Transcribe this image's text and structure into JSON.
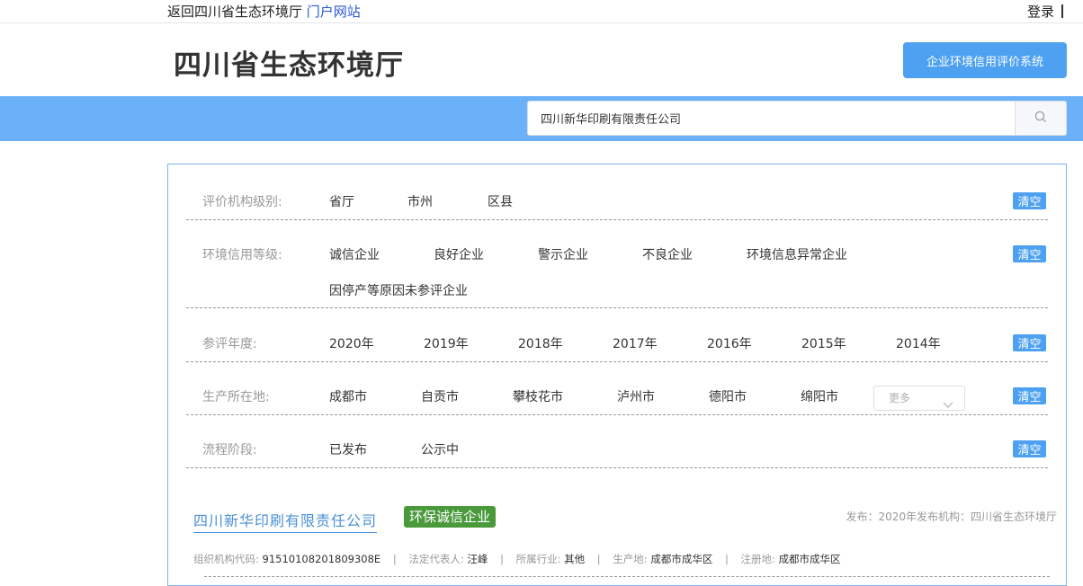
{
  "topbar": {
    "back_text": "返回四川省生态环境厅",
    "portal_link": "门户网站",
    "login": "登录"
  },
  "header": {
    "title": "四川省生态环境厅",
    "system_button": "企业环境信用评价系统"
  },
  "search": {
    "value": "四川新华印刷有限责任公司",
    "icon": "search-icon"
  },
  "filters": {
    "clear_label": "清空",
    "level": {
      "label": "评价机构级别:",
      "options": [
        "省厅",
        "市州",
        "区县"
      ]
    },
    "grade": {
      "label": "环境信用等级:",
      "options": [
        "诚信企业",
        "良好企业",
        "警示企业",
        "不良企业",
        "环境信息异常企业",
        "因停产等原因未参评企业"
      ]
    },
    "year": {
      "label": "参评年度:",
      "options": [
        "2020年",
        "2019年",
        "2018年",
        "2017年",
        "2016年",
        "2015年",
        "2014年"
      ]
    },
    "location": {
      "label": "生产所在地:",
      "options": [
        "成都市",
        "自贡市",
        "攀枝花市",
        "泸州市",
        "德阳市",
        "绵阳市"
      ],
      "more": "更多"
    },
    "stage": {
      "label": "流程阶段:",
      "options": [
        "已发布",
        "公示中"
      ]
    }
  },
  "result": {
    "name": "四川新华印刷有限责任公司",
    "badge": "环保诚信企业",
    "badge_color": "#4a9a3c",
    "meta": "发布：2020年发布机构：四川省生态环境厅",
    "info": {
      "org_code_label": "组织机构代码:",
      "org_code": "91510108201809308E",
      "legal_rep_label": "法定代表人:",
      "legal_rep": "汪峰",
      "industry_label": "所属行业:",
      "industry": "其他",
      "production_label": "生产地:",
      "production": "成都市成华区",
      "registered_label": "注册地:",
      "registered": "成都市成华区"
    }
  },
  "colors": {
    "accent": "#4da1f0",
    "search_band": "#6bb1f9",
    "link": "#2956d6"
  }
}
